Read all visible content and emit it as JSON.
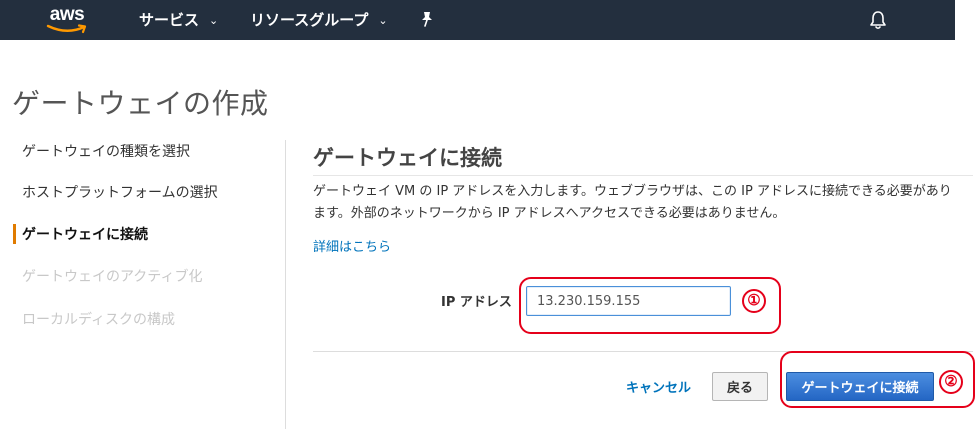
{
  "nav": {
    "logo_text": "aws",
    "services_label": "サービス",
    "resource_groups_label": "リソースグループ",
    "caret_glyph": "⌄",
    "bg_color": "#232f3e",
    "icons": [
      "aws-smile-icon",
      "chevron-down-icon",
      "pin-icon",
      "bell-icon"
    ]
  },
  "page": {
    "title": "ゲートウェイの作成"
  },
  "steps": [
    {
      "label": "ゲートウェイの種類を選択",
      "state": "done"
    },
    {
      "label": "ホストプラットフォームの選択",
      "state": "done"
    },
    {
      "label": "ゲートウェイに接続",
      "state": "current"
    },
    {
      "label": "ゲートウェイのアクティブ化",
      "state": "disabled"
    },
    {
      "label": "ローカルディスクの構成",
      "state": "disabled"
    }
  ],
  "main": {
    "section_title": "ゲートウェイに接続",
    "description": "ゲートウェイ VM の IP アドレスを入力します。ウェブブラウザは、この IP アドレスに接続できる必要があります。外部のネットワークから IP アドレスへアクセスできる必要はありません。",
    "more_link": "詳細はこちら",
    "ip_label": "IP アドレス",
    "ip_value": "13.230.159.155",
    "cancel_label": "キャンセル",
    "back_label": "戻る",
    "connect_label": "ゲートウェイに接続"
  },
  "annotations": {
    "marker_1": "①",
    "marker_2": "②",
    "color": "#e5001a"
  },
  "colors": {
    "accent_orange": "#e07b00",
    "link_blue": "#0073bb",
    "primary_blue": "#2466c4"
  }
}
